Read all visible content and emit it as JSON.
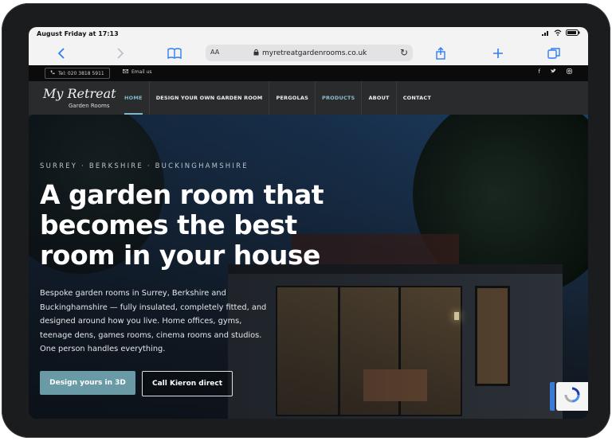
{
  "statusbar": {
    "time": "August Friday at 17:13"
  },
  "safari": {
    "aa_label": "AA",
    "url": "myretreatgardenrooms.co.uk"
  },
  "topbar": {
    "phone": "Tel: 020 3818 5911",
    "email": "Email us",
    "socials": [
      "facebook-icon",
      "twitter-icon",
      "instagram-icon"
    ]
  },
  "logo": {
    "script": "My Retreat",
    "sub": "Garden Rooms"
  },
  "nav": {
    "items": [
      "HOME",
      "DESIGN YOUR OWN GARDEN ROOM",
      "PERGOLAS",
      "PRODUCTS",
      "ABOUT",
      "CONTACT"
    ],
    "active": "HOME"
  },
  "hero": {
    "kicker": "SURREY · BERKSHIRE · BUCKINGHAMSHIRE",
    "headline_lines": [
      "A garden room that",
      "becomes the best",
      "room in your house"
    ],
    "body_lines": [
      "Bespoke garden rooms in Surrey, Berkshire and",
      "Buckinghamshire — fully insulated, completely fitted, and",
      "designed around how you live. Home offices, gyms,",
      "teenage dens, games rooms, cinema rooms and studios.",
      "One person handles everything."
    ],
    "cta_primary": "Design yours in 3D",
    "cta_secondary": "Call Kieron direct"
  },
  "colors": {
    "accent": "#6a9aa6",
    "nav_bg": "#2a2b2d",
    "topbar_bg": "#0b0b0c"
  }
}
